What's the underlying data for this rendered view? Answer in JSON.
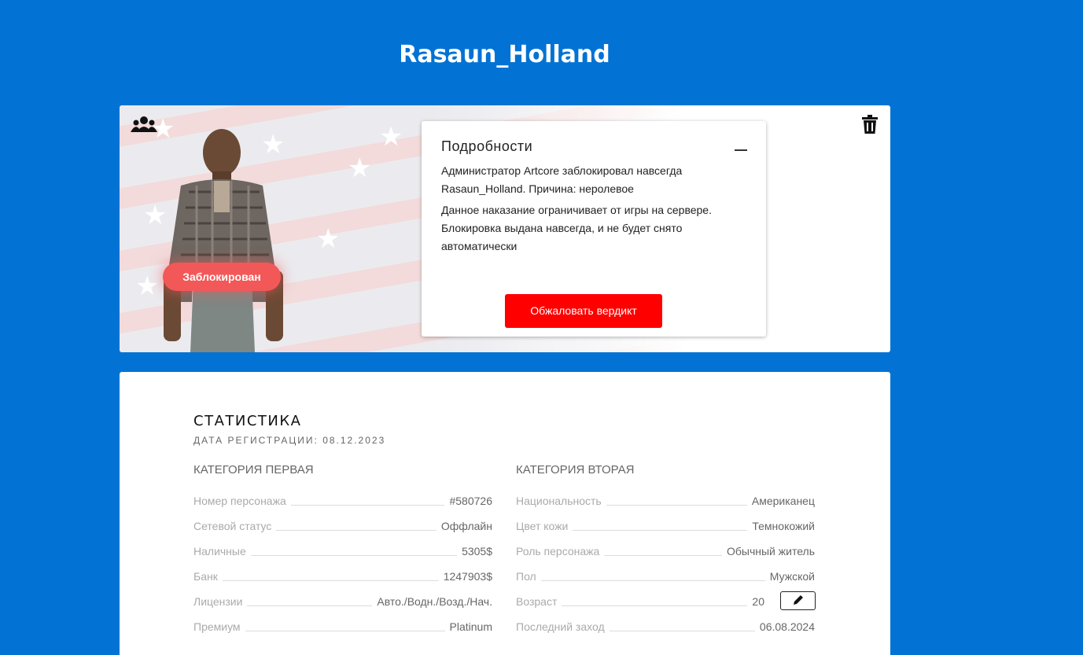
{
  "page": {
    "title": "Rasaun_Holland"
  },
  "hero": {
    "status_badge": "Заблокирован",
    "details": {
      "title": "Подробности",
      "line1": "Администратор Artcore заблокировал навсегда Rasaun_Holland. Причина: неролевое",
      "line2": "Данное наказание ограничивает от игры на сервере. Блокировка выдана навсегда, и не будет снято автоматически",
      "appeal_label": "Обжаловать вердикт"
    },
    "icons": {
      "group": "users-icon",
      "delete": "trash-icon",
      "collapse": "minus-icon"
    }
  },
  "stats": {
    "heading": "СТАТИСТИКА",
    "reg_date": "ДАТА РЕГИСТРАЦИИ: 08.12.2023",
    "category1": {
      "title": "КАТЕГОРИЯ ПЕРВАЯ",
      "rows": [
        {
          "label": "Номер персонажа",
          "value": "#580726"
        },
        {
          "label": "Сетевой статус",
          "value": "Оффлайн"
        },
        {
          "label": "Наличные",
          "value": "5305$"
        },
        {
          "label": "Банк",
          "value": "1247903$"
        },
        {
          "label": "Лицензии",
          "value": "Авто./Водн./Возд./Нач."
        },
        {
          "label": "Премиум",
          "value": "Platinum"
        }
      ]
    },
    "category2": {
      "title": "КАТЕГОРИЯ ВТОРАЯ",
      "rows": [
        {
          "label": "Национальность",
          "value": "Американец"
        },
        {
          "label": "Цвет кожи",
          "value": "Темнокожий"
        },
        {
          "label": "Роль персонажа",
          "value": "Обычный житель"
        },
        {
          "label": "Пол",
          "value": "Мужской"
        },
        {
          "label": "Возраст",
          "value": "20"
        },
        {
          "label": "Последний заход",
          "value": "06.08.2024"
        }
      ]
    }
  },
  "colors": {
    "background": "#0273d4",
    "badge": "#f25858",
    "appeal": "#ff0000"
  }
}
